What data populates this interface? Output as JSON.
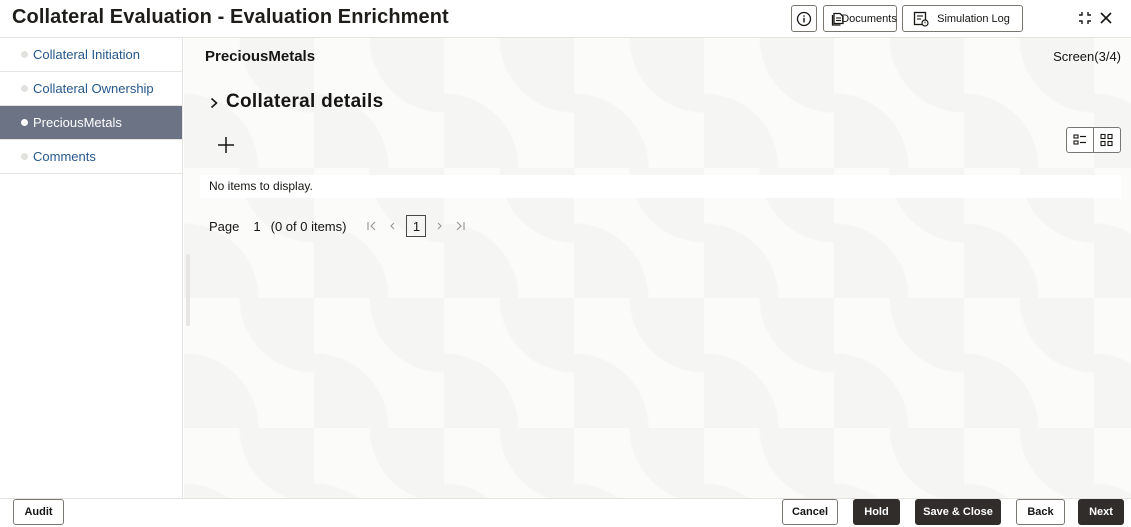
{
  "header": {
    "title": "Collateral Evaluation - Evaluation Enrichment",
    "info_icon": "info-icon",
    "documents_label": "Documents",
    "simulation_log_label": "Simulation Log"
  },
  "sidebar": {
    "items": [
      {
        "label": "Collateral Initiation",
        "active": false
      },
      {
        "label": "Collateral Ownership",
        "active": false
      },
      {
        "label": "PreciousMetals",
        "active": true
      },
      {
        "label": "Comments",
        "active": false
      }
    ]
  },
  "main": {
    "section_title": "PreciousMetals",
    "screen_count": "Screen(3/4)",
    "collateral_title": "Collateral details",
    "empty_message": "No items to display.",
    "pager": {
      "page_label": "Page",
      "page_number": "1",
      "items_count": "(0 of 0 items)",
      "current_page": "1"
    }
  },
  "footer": {
    "audit_label": "Audit",
    "cancel_label": "Cancel",
    "hold_label": "Hold",
    "save_close_label": "Save & Close",
    "back_label": "Back",
    "next_label": "Next"
  },
  "colors": {
    "active_sidebar_bg": "#6b7384",
    "link_blue": "#25578c",
    "dark_button": "#312d2a"
  }
}
